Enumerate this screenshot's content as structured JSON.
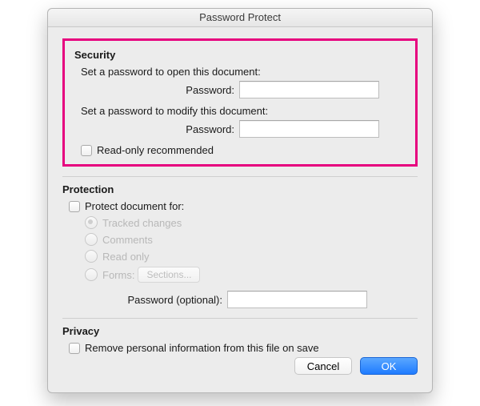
{
  "window": {
    "title": "Password Protect"
  },
  "security": {
    "heading": "Security",
    "open_prompt": "Set a password to open this document:",
    "open_label": "Password:",
    "open_value": "",
    "modify_prompt": "Set a password to modify this document:",
    "modify_label": "Password:",
    "modify_value": "",
    "read_only_label": "Read-only recommended",
    "read_only_checked": false
  },
  "protection": {
    "heading": "Protection",
    "protect_for_label": "Protect document for:",
    "protect_for_checked": false,
    "options": {
      "tracked": "Tracked changes",
      "comments": "Comments",
      "readonly": "Read only",
      "forms": "Forms:",
      "sections_button": "Sections..."
    },
    "password_label": "Password (optional):",
    "password_value": ""
  },
  "privacy": {
    "heading": "Privacy",
    "remove_personal_label": "Remove personal information from this file on save",
    "remove_personal_checked": false
  },
  "buttons": {
    "cancel": "Cancel",
    "ok": "OK"
  }
}
